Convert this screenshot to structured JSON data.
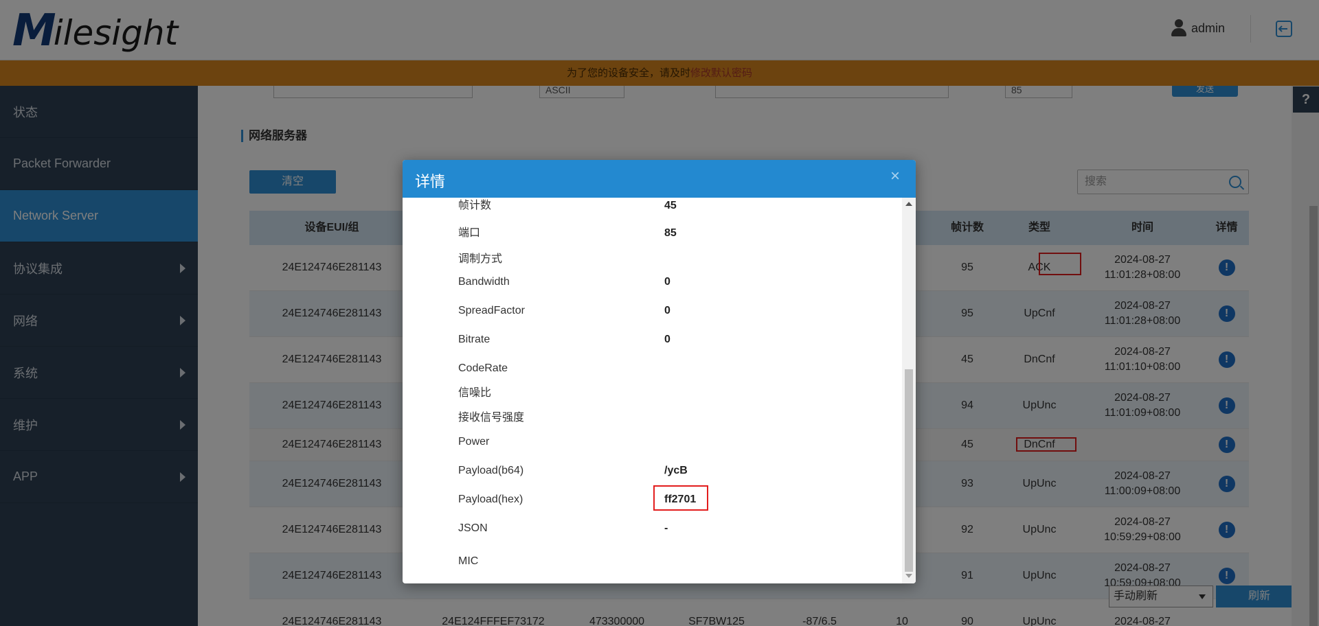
{
  "header": {
    "logo_first": "M",
    "logo_rest": "ilesight",
    "user_name": "admin",
    "user_icon": "user-icon",
    "logout_icon": "logout-icon"
  },
  "notice": {
    "text": "为了您的设备安全，请及时",
    "link": "修改默认密码"
  },
  "sidebar": {
    "items": [
      {
        "label": "状态",
        "has_arrow": false
      },
      {
        "label": "Packet Forwarder",
        "has_arrow": false
      },
      {
        "label": "Network Server",
        "has_arrow": false,
        "active": true
      },
      {
        "label": "协议集成",
        "has_arrow": true
      },
      {
        "label": "网络",
        "has_arrow": true
      },
      {
        "label": "系统",
        "has_arrow": true
      },
      {
        "label": "维护",
        "has_arrow": true
      },
      {
        "label": "APP",
        "has_arrow": true
      }
    ]
  },
  "main": {
    "top_select_2": "ASCII",
    "top_field_port": "85",
    "send_label": "发送",
    "section_title": "网络服务器",
    "clear_label": "清空",
    "search_placeholder": "搜索",
    "table": {
      "headers": {
        "eui": "设备EUI/组",
        "fcnt": "帧计数",
        "type": "类型",
        "time": "时间",
        "detail": "详情"
      },
      "rows": [
        {
          "eui": "24E124746E281143",
          "fcnt": "95",
          "type": "ACK",
          "date": "2024-08-27",
          "time": "11:01:28+08:00"
        },
        {
          "eui": "24E124746E281143",
          "fcnt": "95",
          "type": "UpCnf",
          "date": "2024-08-27",
          "time": "11:01:28+08:00"
        },
        {
          "eui": "24E124746E281143",
          "fcnt": "45",
          "type": "DnCnf",
          "date": "2024-08-27",
          "time": "11:01:10+08:00"
        },
        {
          "eui": "24E124746E281143",
          "fcnt": "94",
          "type": "UpUnc",
          "date": "2024-08-27",
          "time": "11:01:09+08:00"
        },
        {
          "eui": "24E124746E281143",
          "fcnt": "45",
          "type": "DnCnf",
          "date": "",
          "time": ""
        },
        {
          "eui": "24E124746E281143",
          "fcnt": "93",
          "type": "UpUnc",
          "date": "2024-08-27",
          "time": "11:00:09+08:00"
        },
        {
          "eui": "24E124746E281143",
          "fcnt": "92",
          "type": "UpUnc",
          "date": "2024-08-27",
          "time": "10:59:29+08:00"
        },
        {
          "eui": "24E124746E281143",
          "fcnt": "91",
          "type": "UpUnc",
          "date": "2024-08-27",
          "time": "10:59:09+08:00"
        },
        {
          "eui": "24E124746E281143",
          "fcnt": "90",
          "type": "UpUnc",
          "date": "2024-08-27",
          "time": "",
          "gateway": "24E124FFFEF73172",
          "freq": "473300000",
          "dr": "SF7BW125",
          "signal": "-87/6.5",
          "size": "10"
        }
      ]
    },
    "refresh_mode": "手动刷新",
    "refresh_label": "刷新",
    "help_label": "?"
  },
  "modal": {
    "title": "详情",
    "close_label": "×",
    "fields": [
      {
        "label": "帧计数",
        "value": "45"
      },
      {
        "label": "端口",
        "value": "85"
      },
      {
        "label": "调制方式",
        "value": ""
      },
      {
        "label": "Bandwidth",
        "value": "0"
      },
      {
        "label": "SpreadFactor",
        "value": "0"
      },
      {
        "label": "Bitrate",
        "value": "0"
      },
      {
        "label": "CodeRate",
        "value": ""
      },
      {
        "label": "信噪比",
        "value": ""
      },
      {
        "label": "接收信号强度",
        "value": ""
      },
      {
        "label": "Power",
        "value": ""
      },
      {
        "label": "Payload(b64)",
        "value": "/ycB"
      },
      {
        "label": "Payload(hex)",
        "value": "ff2701"
      },
      {
        "label": "JSON",
        "value": "-"
      },
      {
        "label": "MIC",
        "value": ""
      }
    ]
  },
  "colors": {
    "accent": "#2e8fd4",
    "sidebar_bg": "#2f4154",
    "notice_bg": "#d9861f",
    "highlight": "#e21d1d"
  }
}
